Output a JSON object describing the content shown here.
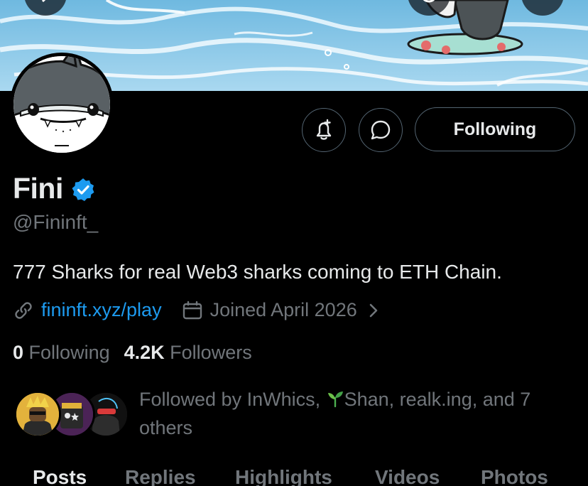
{
  "profile": {
    "name": "Fini",
    "handle": "@Fininft_",
    "bio": "777 Sharks for real Web3 sharks coming to ETH Chain.",
    "website": "fininft.xyz/play",
    "joined": "Joined April 2026",
    "following_count": "0",
    "following_label": "Following",
    "followers_count": "4.2K",
    "followers_label": "Followers",
    "verified": true
  },
  "actions": {
    "follow_label": "Following"
  },
  "followed_by": {
    "prefix": "Followed by InWhics, ",
    "sprout_icon": "sprout-icon",
    "rest": "Shan, realk.ing, and 7 others"
  },
  "tabs": [
    {
      "label": "Posts",
      "active": true
    },
    {
      "label": "Replies",
      "active": false
    },
    {
      "label": "Highlights",
      "active": false
    },
    {
      "label": "Videos",
      "active": false
    },
    {
      "label": "Photos",
      "active": false
    }
  ],
  "icons": {
    "back": "back-arrow-icon",
    "more": "more-icon",
    "search": "search-icon",
    "notify": "bell-plus-icon",
    "message": "message-icon",
    "link": "link-icon",
    "calendar": "calendar-icon",
    "chevron": "chevron-right-icon",
    "verified": "verified-badge-icon"
  },
  "colors": {
    "background": "#000000",
    "text_primary": "#e7e9ea",
    "text_secondary": "#71767b",
    "accent": "#1d9bf0",
    "border": "#536471"
  }
}
